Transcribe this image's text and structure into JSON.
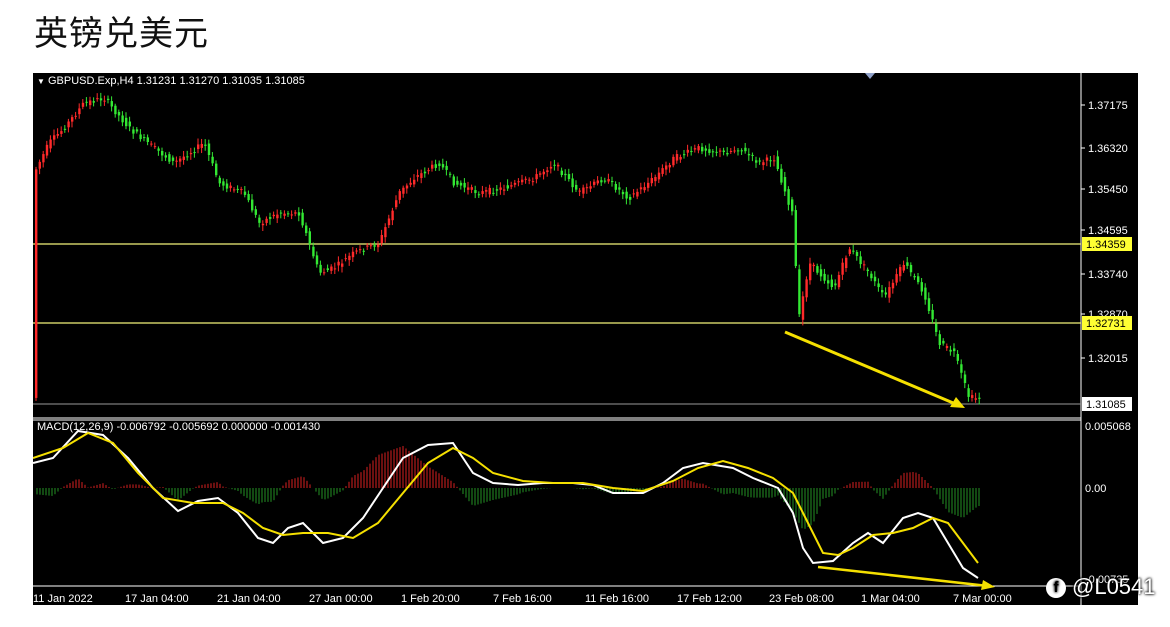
{
  "page": {
    "title": "英镑兑美元"
  },
  "chart": {
    "symbol_line": "GBPUSD.Exp,H4  1.31231 1.31270 1.31035 1.31085",
    "price_axis": [
      "1.37175",
      "1.36320",
      "1.35450",
      "1.34595",
      "1.33740",
      "1.32870",
      "1.32015",
      "1.31085"
    ],
    "level_labels": [
      "1.34359",
      "1.32731"
    ],
    "current_price": "1.31085",
    "macd_label": "MACD(12,26,9) -0.006792 -0.005692 0.000000 -0.001430",
    "macd_axis": [
      "0.005068",
      "0.00",
      "-0.00735"
    ],
    "time_axis": [
      "11 Jan 2022",
      "17 Jan 04:00",
      "21 Jan 04:00",
      "27 Jan 00:00",
      "1 Feb 20:00",
      "7 Feb 16:00",
      "11 Feb 16:00",
      "17 Feb 12:00",
      "23 Feb 08:00",
      "1 Mar 04:00",
      "7 Mar 00:00"
    ],
    "colors": {
      "up": "#ff2a2a",
      "down": "#33e833",
      "level": "#ffff66",
      "arrow": "#f5e000",
      "macd": "#ffffff",
      "signal": "#f5e000"
    }
  },
  "watermark": {
    "icon": "f",
    "text": "@L0541"
  }
}
